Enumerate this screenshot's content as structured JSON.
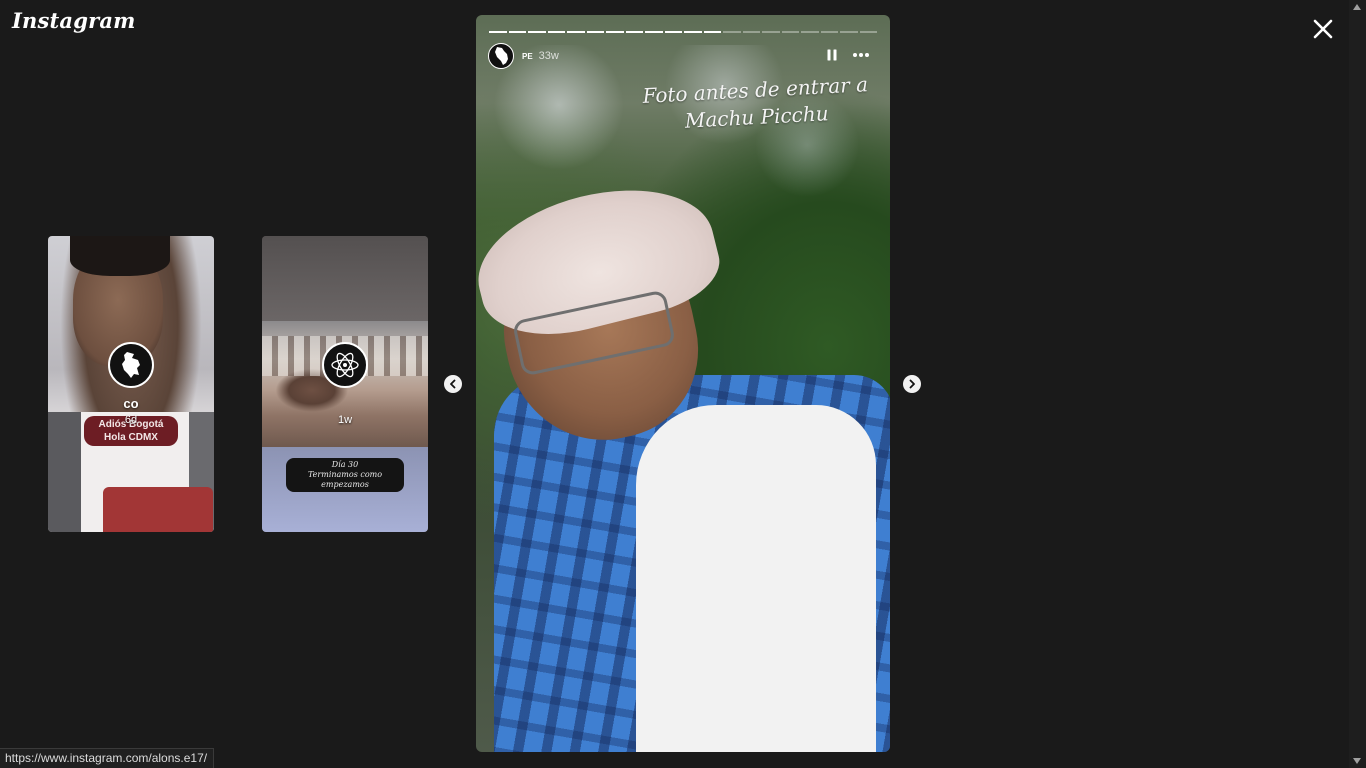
{
  "app": {
    "logo_text": "Instagram"
  },
  "status_bar": {
    "url": "https://www.instagram.com/alons.e17/"
  },
  "previews": [
    {
      "username": "co",
      "time": "6d",
      "sticker_line1": "Adiós Bogotá",
      "sticker_line2": "Hola CDMX",
      "avatar_icon": "colombia-map-icon"
    },
    {
      "username": "",
      "time": "1w",
      "caption_line1": "Día 30",
      "caption_line2": "Terminamos como empezamos",
      "avatar_icon": "atom-icon"
    }
  ],
  "story": {
    "username": "PE",
    "time": "33w",
    "caption_line1": "Foto antes de entrar a",
    "caption_line2": "Machu Picchu",
    "avatar_icon": "peru-map-icon",
    "progress": {
      "total_segments": 20,
      "completed_segments": 12
    }
  },
  "colors": {
    "background": "#1a1a1a",
    "shirt_blue": "#3f7fd1",
    "sticker_red": "#6d1d24"
  }
}
